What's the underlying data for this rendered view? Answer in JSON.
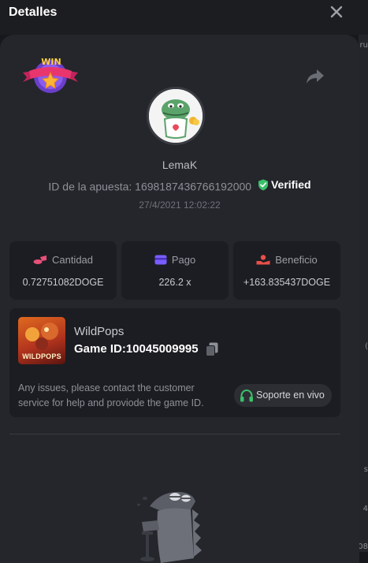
{
  "modal": {
    "title": "Detalles"
  },
  "badge": {
    "label": "WIN"
  },
  "bet": {
    "username": "LemaK",
    "id_label": "ID de la apuesta:",
    "id_value": "1698187436766192000",
    "verified_label": "Verified",
    "timestamp": "27/4/2021 12:02:22"
  },
  "stats": {
    "amount": {
      "label": "Cantidad",
      "value": "0.72751082DOGE"
    },
    "payout": {
      "label": "Pago",
      "value": "226.2 x"
    },
    "profit": {
      "label": "Beneficio",
      "value": "+163.835437DOGE"
    }
  },
  "game": {
    "thumb_text": "WILDPOPS",
    "name": "WildPops",
    "id_text": "Game ID:10045009995",
    "issues_text": "Any issues, please contact the customer service for help and proviode the game ID.",
    "support_label": "Soporte en vivo"
  },
  "backdrop": {
    "fragments": [
      "ru",
      "(",
      "s",
      "4",
      "08"
    ]
  },
  "colors": {
    "panel": "#24262b",
    "card": "#1c1d22",
    "verified_green": "#3bc06b",
    "amount_icon": "#e8507a",
    "payout_icon": "#7a5cff",
    "profit_icon": "#e8504a",
    "support_icon": "#3bc06b"
  },
  "icons": {
    "close": "close-icon",
    "share": "share-icon",
    "verified": "shield-check-icon",
    "amount": "coins-icon",
    "payout": "card-icon",
    "profit": "hand-coin-icon",
    "copy": "copy-icon",
    "support": "headset-icon"
  }
}
